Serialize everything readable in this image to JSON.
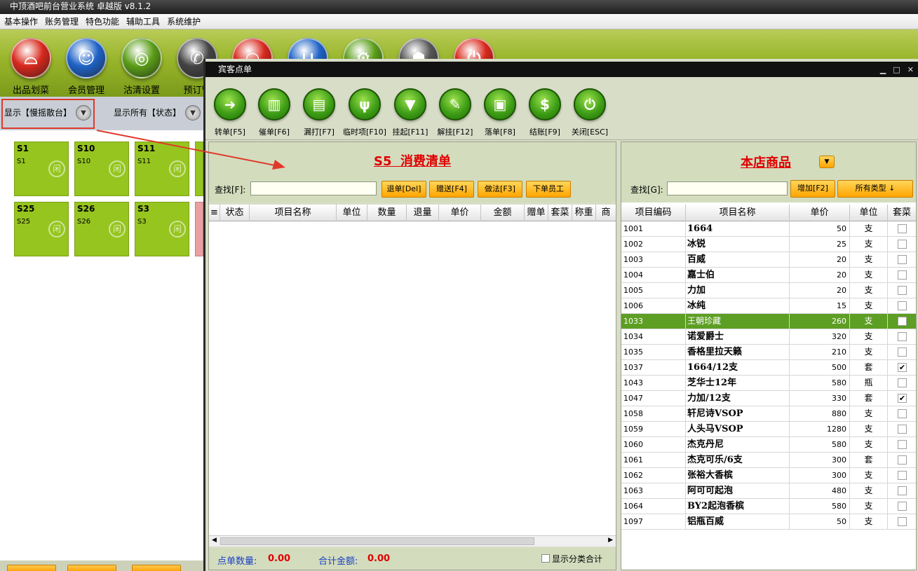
{
  "app": {
    "title": "中顶酒吧前台营业系统 卓越版 v8.1.2"
  },
  "menu": [
    "基本操作",
    "账务管理",
    "特色功能",
    "辅助工具",
    "系统维护"
  ],
  "main_toolbar": [
    {
      "label": "出品划菜",
      "icon": "cloche-icon",
      "color": "#d8281c"
    },
    {
      "label": "会员管理",
      "icon": "member-icon",
      "color": "#1f63c7"
    },
    {
      "label": "沽清设置",
      "icon": "plate-icon",
      "color": "#5a9d17"
    },
    {
      "label": "预订管",
      "icon": "phone-icon",
      "color": "#444444"
    },
    {
      "label": "",
      "icon": "search-icon",
      "color": "#d8281c"
    },
    {
      "label": "",
      "icon": "basket-icon",
      "color": "#1f63c7"
    },
    {
      "label": "",
      "icon": "gear-icon",
      "color": "#5a9d17"
    },
    {
      "label": "",
      "icon": "people-icon",
      "color": "#555555"
    },
    {
      "label": "",
      "icon": "power-icon",
      "color": "#d8281c"
    }
  ],
  "left": {
    "filter1": "显示【慢摇散台】",
    "filter2": "显示所有【状态】",
    "tables": [
      {
        "code": "S1",
        "name": "S1"
      },
      {
        "code": "S10",
        "name": "S10"
      },
      {
        "code": "S11",
        "name": "S11"
      },
      {
        "code": "S25",
        "name": "S25"
      },
      {
        "code": "S26",
        "name": "S26"
      },
      {
        "code": "S3",
        "name": "S3"
      }
    ]
  },
  "dialog": {
    "title": "宾客点单",
    "toolbar": [
      {
        "label": "转单[F5]",
        "icon": "arrow-icon",
        "glyph": "➜"
      },
      {
        "label": "催单[F6]",
        "icon": "bank-icon",
        "glyph": "▥"
      },
      {
        "label": "漏打[F7]",
        "icon": "document-icon",
        "glyph": "▤"
      },
      {
        "label": "临时项[F10]",
        "icon": "cutlery-icon",
        "glyph": "ψ"
      },
      {
        "label": "挂起[F11]",
        "icon": "tie-icon",
        "glyph": "▼"
      },
      {
        "label": "解挂[F12]",
        "icon": "pen-icon",
        "glyph": "✎"
      },
      {
        "label": "落单[F8]",
        "icon": "screen-icon",
        "glyph": "▣"
      },
      {
        "label": "结账[F9]",
        "icon": "dollar-icon",
        "glyph": "$"
      },
      {
        "label": "关闭[ESC]",
        "icon": "power-icon",
        "glyph": "⏻"
      }
    ],
    "order": {
      "title": "S5  消费清单",
      "find_label": "查找[F]:",
      "buttons": [
        "退单[Del]",
        "赠送[F4]",
        "做法[F3]",
        "下单员工"
      ],
      "columns": [
        "状态",
        "项目名称",
        "单位",
        "数量",
        "退量",
        "单价",
        "金额",
        "赠单",
        "套菜",
        "称重",
        "商"
      ],
      "count_label": "点单数量:",
      "count_value": "0.00",
      "total_label": "合计金额:",
      "total_value": "0.00",
      "show_category": "显示分类合计"
    },
    "products": {
      "title": "本店商品",
      "find_label": "查找[G]:",
      "add_button": "增加[F2]",
      "type_button": "所有类型 ↓",
      "columns": [
        "项目编码",
        "项目名称",
        "单价",
        "单位",
        "套菜"
      ],
      "rows": [
        {
          "code": "1001",
          "name": "1664",
          "price": "50",
          "unit": "支",
          "set": false
        },
        {
          "code": "1002",
          "name": "冰锐",
          "price": "25",
          "unit": "支",
          "set": false
        },
        {
          "code": "1003",
          "name": "百威",
          "price": "20",
          "unit": "支",
          "set": false
        },
        {
          "code": "1004",
          "name": "嘉士伯",
          "price": "20",
          "unit": "支",
          "set": false
        },
        {
          "code": "1005",
          "name": "力加",
          "price": "20",
          "unit": "支",
          "set": false
        },
        {
          "code": "1006",
          "name": "冰纯",
          "price": "15",
          "unit": "支",
          "set": false
        },
        {
          "code": "1033",
          "name": "王朝珍藏",
          "price": "260",
          "unit": "支",
          "set": false,
          "selected": true
        },
        {
          "code": "1034",
          "name": "诺爱爵士",
          "price": "320",
          "unit": "支",
          "set": false
        },
        {
          "code": "1035",
          "name": "香格里拉天籁",
          "price": "210",
          "unit": "支",
          "set": false
        },
        {
          "code": "1037",
          "name": "1664/12支",
          "price": "500",
          "unit": "套",
          "set": true
        },
        {
          "code": "1043",
          "name": "芝华士12年",
          "price": "580",
          "unit": "瓶",
          "set": false
        },
        {
          "code": "1047",
          "name": "力加/12支",
          "price": "330",
          "unit": "套",
          "set": true
        },
        {
          "code": "1058",
          "name": "轩尼诗VSOP",
          "price": "880",
          "unit": "支",
          "set": false
        },
        {
          "code": "1059",
          "name": "人头马VSOP",
          "price": "1280",
          "unit": "支",
          "set": false
        },
        {
          "code": "1060",
          "name": "杰克丹尼",
          "price": "580",
          "unit": "支",
          "set": false
        },
        {
          "code": "1061",
          "name": "杰克可乐/6支",
          "price": "300",
          "unit": "套",
          "set": false
        },
        {
          "code": "1062",
          "name": "张裕大香槟",
          "price": "300",
          "unit": "支",
          "set": false
        },
        {
          "code": "1063",
          "name": "阿可可起泡",
          "price": "480",
          "unit": "支",
          "set": false
        },
        {
          "code": "1064",
          "name": "BY2起泡香槟",
          "price": "580",
          "unit": "支",
          "set": false
        },
        {
          "code": "1097",
          "name": "铝瓶百威",
          "price": "50",
          "unit": "支",
          "set": false
        }
      ]
    }
  },
  "colors": {
    "accent_red": "#e00000",
    "tile_green": "#96c51f",
    "selected_row": "#5d9e24",
    "orange_button": "#ffa500"
  }
}
